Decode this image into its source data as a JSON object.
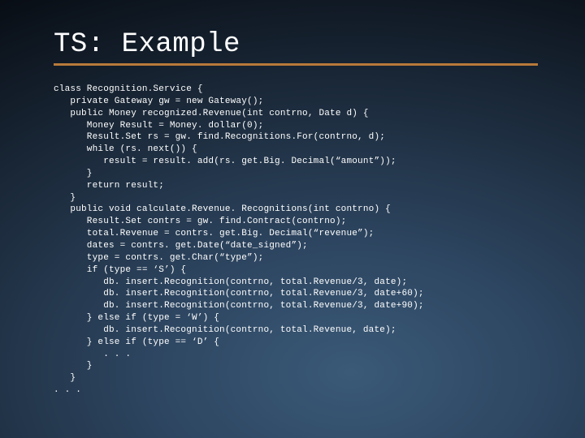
{
  "slide": {
    "title": "TS: Example",
    "code": "class Recognition.Service {\n   private Gateway gw = new Gateway();\n   public Money recognized.Revenue(int contrno, Date d) {\n      Money Result = Money. dollar(0);\n      Result.Set rs = gw. find.Recognitions.For(contrno, d);\n      while (rs. next()) {\n         result = result. add(rs. get.Big. Decimal(“amount”));\n      }\n      return result;\n   }\n   public void calculate.Revenue. Recognitions(int contrno) {\n      Result.Set contrs = gw. find.Contract(contrno);\n      total.Revenue = contrs. get.Big. Decimal(“revenue”);\n      dates = contrs. get.Date(“date_signed”);\n      type = contrs. get.Char(“type”);\n      if (type == ‘S’) {\n         db. insert.Recognition(contrno, total.Revenue/3, date);\n         db. insert.Recognition(contrno, total.Revenue/3, date+60);\n         db. insert.Recognition(contrno, total.Revenue/3, date+90);\n      } else if (type = ‘W’) {\n         db. insert.Recognition(contrno, total.Revenue, date);\n      } else if (type == ‘D’ {\n         . . .\n      }\n   }\n. . ."
  }
}
